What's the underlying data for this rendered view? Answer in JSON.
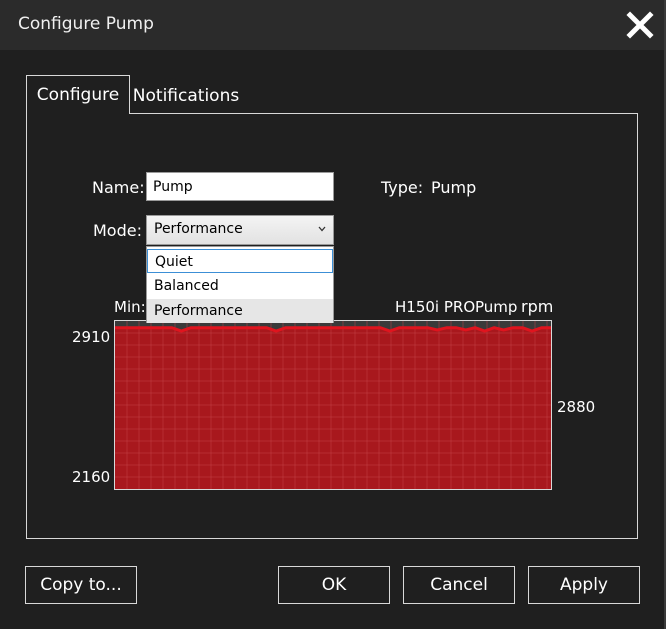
{
  "window": {
    "title": "Configure Pump",
    "close_icon": "close-icon"
  },
  "tabs": [
    {
      "label": "Configure",
      "active": true
    },
    {
      "label": "Notifications",
      "active": false
    }
  ],
  "form": {
    "name_label": "Name:",
    "name_value": "Pump",
    "type_label": "Type:",
    "type_value": "Pump",
    "mode_label": "Mode:",
    "mode_value": "Performance",
    "mode_options": [
      "Quiet",
      "Balanced",
      "Performance"
    ],
    "focused_option": "Quiet"
  },
  "graph": {
    "min_label": "Min:",
    "device_label": "H150i PRO",
    "sensor_label": "Pump",
    "unit_label": "rpm",
    "current_value": "2880"
  },
  "chart_data": {
    "type": "area",
    "ylim": [
      2160,
      2910
    ],
    "y_tick_labels": [
      "2910",
      "2160"
    ],
    "values": [
      2880,
      2880,
      2880,
      2880,
      2880,
      2880,
      2880,
      2865,
      2880,
      2880,
      2880,
      2880,
      2880,
      2880,
      2880,
      2880,
      2880,
      2865,
      2880,
      2880,
      2880,
      2880,
      2880,
      2880,
      2880,
      2880,
      2880,
      2880,
      2880,
      2865,
      2880,
      2880,
      2880,
      2880,
      2870,
      2880,
      2880,
      2870,
      2880,
      2865,
      2880,
      2870,
      2880,
      2880,
      2865,
      2880,
      2880
    ],
    "colors": {
      "fill": "#a8181d",
      "line": "#e0141e",
      "background": "#3a3a3a",
      "grid": "#c8454a"
    },
    "grid": true
  },
  "buttons": {
    "copy_to": "Copy to...",
    "ok": "OK",
    "cancel": "Cancel",
    "apply": "Apply"
  }
}
